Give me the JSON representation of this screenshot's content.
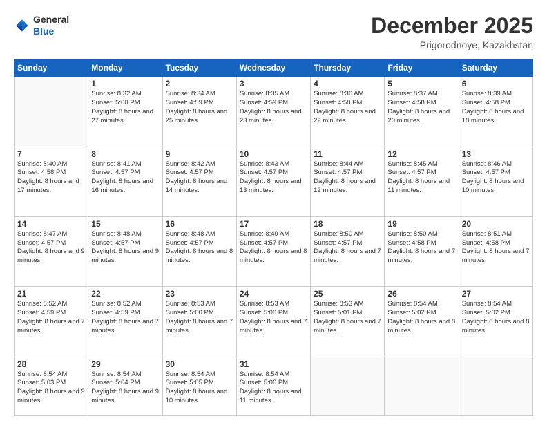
{
  "logo": {
    "general": "General",
    "blue": "Blue"
  },
  "header": {
    "month": "December 2025",
    "location": "Prigorodnoye, Kazakhstan"
  },
  "weekdays": [
    "Sunday",
    "Monday",
    "Tuesday",
    "Wednesday",
    "Thursday",
    "Friday",
    "Saturday"
  ],
  "weeks": [
    [
      {
        "day": "",
        "sunrise": "",
        "sunset": "",
        "daylight": ""
      },
      {
        "day": "1",
        "sunrise": "Sunrise: 8:32 AM",
        "sunset": "Sunset: 5:00 PM",
        "daylight": "Daylight: 8 hours and 27 minutes."
      },
      {
        "day": "2",
        "sunrise": "Sunrise: 8:34 AM",
        "sunset": "Sunset: 4:59 PM",
        "daylight": "Daylight: 8 hours and 25 minutes."
      },
      {
        "day": "3",
        "sunrise": "Sunrise: 8:35 AM",
        "sunset": "Sunset: 4:59 PM",
        "daylight": "Daylight: 8 hours and 23 minutes."
      },
      {
        "day": "4",
        "sunrise": "Sunrise: 8:36 AM",
        "sunset": "Sunset: 4:58 PM",
        "daylight": "Daylight: 8 hours and 22 minutes."
      },
      {
        "day": "5",
        "sunrise": "Sunrise: 8:37 AM",
        "sunset": "Sunset: 4:58 PM",
        "daylight": "Daylight: 8 hours and 20 minutes."
      },
      {
        "day": "6",
        "sunrise": "Sunrise: 8:39 AM",
        "sunset": "Sunset: 4:58 PM",
        "daylight": "Daylight: 8 hours and 18 minutes."
      }
    ],
    [
      {
        "day": "7",
        "sunrise": "Sunrise: 8:40 AM",
        "sunset": "Sunset: 4:58 PM",
        "daylight": "Daylight: 8 hours and 17 minutes."
      },
      {
        "day": "8",
        "sunrise": "Sunrise: 8:41 AM",
        "sunset": "Sunset: 4:57 PM",
        "daylight": "Daylight: 8 hours and 16 minutes."
      },
      {
        "day": "9",
        "sunrise": "Sunrise: 8:42 AM",
        "sunset": "Sunset: 4:57 PM",
        "daylight": "Daylight: 8 hours and 14 minutes."
      },
      {
        "day": "10",
        "sunrise": "Sunrise: 8:43 AM",
        "sunset": "Sunset: 4:57 PM",
        "daylight": "Daylight: 8 hours and 13 minutes."
      },
      {
        "day": "11",
        "sunrise": "Sunrise: 8:44 AM",
        "sunset": "Sunset: 4:57 PM",
        "daylight": "Daylight: 8 hours and 12 minutes."
      },
      {
        "day": "12",
        "sunrise": "Sunrise: 8:45 AM",
        "sunset": "Sunset: 4:57 PM",
        "daylight": "Daylight: 8 hours and 11 minutes."
      },
      {
        "day": "13",
        "sunrise": "Sunrise: 8:46 AM",
        "sunset": "Sunset: 4:57 PM",
        "daylight": "Daylight: 8 hours and 10 minutes."
      }
    ],
    [
      {
        "day": "14",
        "sunrise": "Sunrise: 8:47 AM",
        "sunset": "Sunset: 4:57 PM",
        "daylight": "Daylight: 8 hours and 9 minutes."
      },
      {
        "day": "15",
        "sunrise": "Sunrise: 8:48 AM",
        "sunset": "Sunset: 4:57 PM",
        "daylight": "Daylight: 8 hours and 9 minutes."
      },
      {
        "day": "16",
        "sunrise": "Sunrise: 8:48 AM",
        "sunset": "Sunset: 4:57 PM",
        "daylight": "Daylight: 8 hours and 8 minutes."
      },
      {
        "day": "17",
        "sunrise": "Sunrise: 8:49 AM",
        "sunset": "Sunset: 4:57 PM",
        "daylight": "Daylight: 8 hours and 8 minutes."
      },
      {
        "day": "18",
        "sunrise": "Sunrise: 8:50 AM",
        "sunset": "Sunset: 4:57 PM",
        "daylight": "Daylight: 8 hours and 7 minutes."
      },
      {
        "day": "19",
        "sunrise": "Sunrise: 8:50 AM",
        "sunset": "Sunset: 4:58 PM",
        "daylight": "Daylight: 8 hours and 7 minutes."
      },
      {
        "day": "20",
        "sunrise": "Sunrise: 8:51 AM",
        "sunset": "Sunset: 4:58 PM",
        "daylight": "Daylight: 8 hours and 7 minutes."
      }
    ],
    [
      {
        "day": "21",
        "sunrise": "Sunrise: 8:52 AM",
        "sunset": "Sunset: 4:59 PM",
        "daylight": "Daylight: 8 hours and 7 minutes."
      },
      {
        "day": "22",
        "sunrise": "Sunrise: 8:52 AM",
        "sunset": "Sunset: 4:59 PM",
        "daylight": "Daylight: 8 hours and 7 minutes."
      },
      {
        "day": "23",
        "sunrise": "Sunrise: 8:53 AM",
        "sunset": "Sunset: 5:00 PM",
        "daylight": "Daylight: 8 hours and 7 minutes."
      },
      {
        "day": "24",
        "sunrise": "Sunrise: 8:53 AM",
        "sunset": "Sunset: 5:00 PM",
        "daylight": "Daylight: 8 hours and 7 minutes."
      },
      {
        "day": "25",
        "sunrise": "Sunrise: 8:53 AM",
        "sunset": "Sunset: 5:01 PM",
        "daylight": "Daylight: 8 hours and 7 minutes."
      },
      {
        "day": "26",
        "sunrise": "Sunrise: 8:54 AM",
        "sunset": "Sunset: 5:02 PM",
        "daylight": "Daylight: 8 hours and 8 minutes."
      },
      {
        "day": "27",
        "sunrise": "Sunrise: 8:54 AM",
        "sunset": "Sunset: 5:02 PM",
        "daylight": "Daylight: 8 hours and 8 minutes."
      }
    ],
    [
      {
        "day": "28",
        "sunrise": "Sunrise: 8:54 AM",
        "sunset": "Sunset: 5:03 PM",
        "daylight": "Daylight: 8 hours and 9 minutes."
      },
      {
        "day": "29",
        "sunrise": "Sunrise: 8:54 AM",
        "sunset": "Sunset: 5:04 PM",
        "daylight": "Daylight: 8 hours and 9 minutes."
      },
      {
        "day": "30",
        "sunrise": "Sunrise: 8:54 AM",
        "sunset": "Sunset: 5:05 PM",
        "daylight": "Daylight: 8 hours and 10 minutes."
      },
      {
        "day": "31",
        "sunrise": "Sunrise: 8:54 AM",
        "sunset": "Sunset: 5:06 PM",
        "daylight": "Daylight: 8 hours and 11 minutes."
      },
      {
        "day": "",
        "sunrise": "",
        "sunset": "",
        "daylight": ""
      },
      {
        "day": "",
        "sunrise": "",
        "sunset": "",
        "daylight": ""
      },
      {
        "day": "",
        "sunrise": "",
        "sunset": "",
        "daylight": ""
      }
    ]
  ]
}
